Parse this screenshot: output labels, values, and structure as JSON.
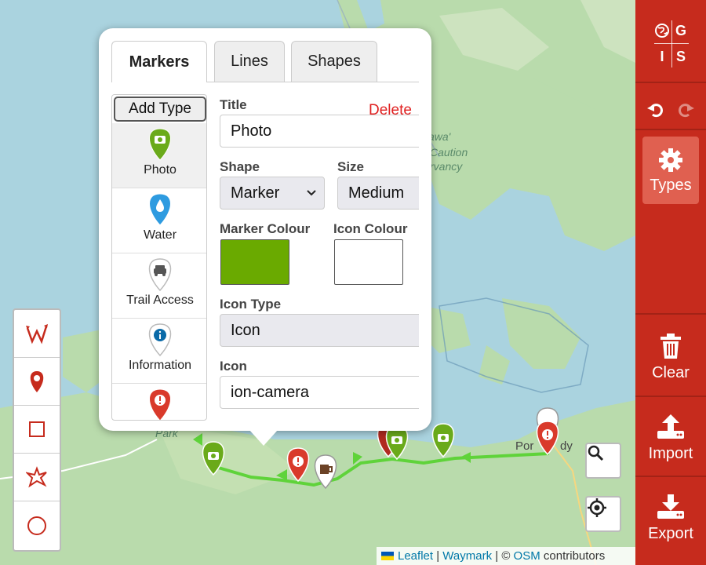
{
  "toolbar": {
    "logo_letters": [
      "G",
      "I",
      "S"
    ],
    "types_label": "Types",
    "clear_label": "Clear",
    "import_label": "Import",
    "export_label": "Export",
    "color": "#c62b1d"
  },
  "panel": {
    "tabs": [
      {
        "label": "Markers",
        "active": true
      },
      {
        "label": "Lines",
        "active": false
      },
      {
        "label": "Shapes",
        "active": false
      }
    ],
    "add_type_label": "Add Type",
    "types": [
      {
        "label": "Photo",
        "color": "#6aaa1a",
        "icon": "camera-icon",
        "selected": true
      },
      {
        "label": "Water",
        "color": "#2e9be0",
        "icon": "water-drop-icon"
      },
      {
        "label": "Trail Access",
        "color": "#ffffff",
        "icon": "car-icon"
      },
      {
        "label": "Information",
        "color": "#ffffff",
        "icon": "info-icon"
      },
      {
        "label": "",
        "color": "#d93a2b",
        "icon": "alert-icon"
      }
    ],
    "delete_label": "Delete",
    "fields": {
      "title_label": "Title",
      "title_value": "Photo",
      "shape_label": "Shape",
      "shape_value": "Marker",
      "size_label": "Size",
      "size_value": "Medium",
      "marker_colour_label": "Marker Colour",
      "marker_colour": "#6aaa00",
      "icon_colour_label": "Icon Colour",
      "icon_colour": "#ffffff",
      "icon_type_label": "Icon Type",
      "icon_type_value": "Icon",
      "icon_label": "Icon",
      "icon_value": "ion-camera"
    }
  },
  "map": {
    "labels": {
      "park": "Park",
      "port": "Por",
      "dy": "dy",
      "awa": "awa'",
      "caution": "Caution",
      "rvancy": "rvancy"
    },
    "attribution": {
      "leaflet": "Leaflet",
      "sep1": "|",
      "waymark": "Waymark",
      "copy": "| ©",
      "osm": "OSM",
      "contributors": "contributors"
    }
  }
}
